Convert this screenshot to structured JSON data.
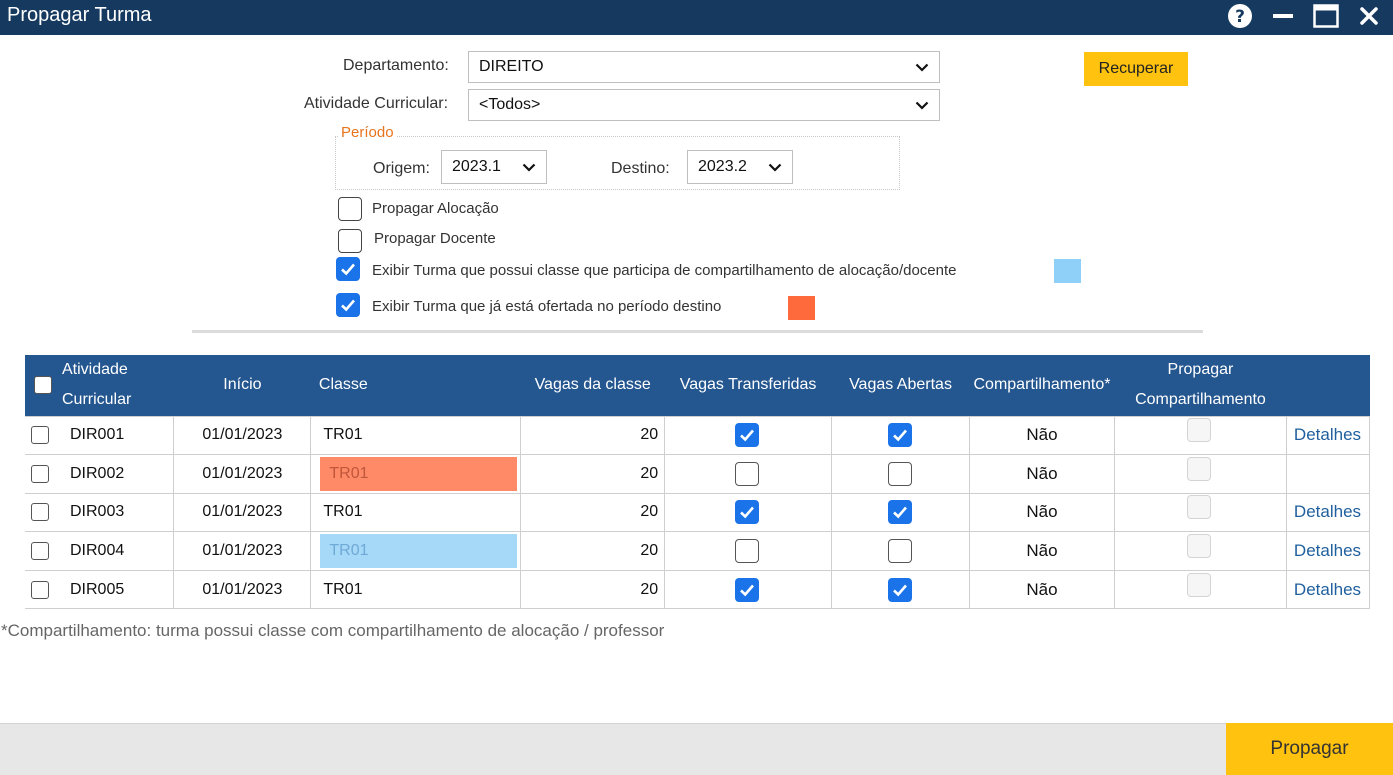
{
  "window": {
    "title": "Propagar Turma"
  },
  "icons": {
    "help": "help-icon",
    "minimize": "minimize-icon",
    "maximize": "maximize-icon",
    "close": "close-icon"
  },
  "filters": {
    "departamento_label": "Departamento:",
    "departamento_value": "DIREITO",
    "atividade_label": "Atividade Curricular:",
    "atividade_value": "<Todos>",
    "recuperar_label": "Recuperar"
  },
  "periodo": {
    "legend": "Período",
    "origem_label": "Origem:",
    "origem_value": "2023.1",
    "destino_label": "Destino:",
    "destino_value": "2023.2"
  },
  "options": {
    "propagar_alocacao": {
      "label": "Propagar Alocação",
      "checked": false
    },
    "propagar_docente": {
      "label": "Propagar Docente",
      "checked": false
    },
    "exibir_compartilhamento": {
      "label": "Exibir Turma que possui classe que participa de compartilhamento de alocação/docente",
      "checked": true,
      "color": "#8fd0f8"
    },
    "exibir_ofertada": {
      "label": "Exibir Turma que já está ofertada no período destino",
      "checked": true,
      "color": "#ff6a3d"
    }
  },
  "table": {
    "headers": {
      "atividade_line1": "Atividade",
      "atividade_line2": "Curricular",
      "inicio": "Início",
      "classe": "Classe",
      "vagas_classe": "Vagas da classe",
      "vagas_transferidas": "Vagas Transferidas",
      "vagas_abertas": "Vagas Abertas",
      "compartilhamento": "Compartilhamento*",
      "propagar_line1": "Propagar",
      "propagar_line2": "Compartilhamento"
    },
    "rows": [
      {
        "atividade": "DIR001",
        "inicio": "01/01/2023",
        "classe": "TR01",
        "vagas": "20",
        "transferidas": true,
        "abertas": true,
        "compartilhamento": "Não",
        "detalhes": "Detalhes"
      },
      {
        "atividade": "DIR002",
        "inicio": "01/01/2023",
        "classe": "TR01",
        "vagas": "20",
        "transferidas": false,
        "abertas": false,
        "compartilhamento": "Não",
        "detalhes": ""
      },
      {
        "atividade": "DIR003",
        "inicio": "01/01/2023",
        "classe": "TR01",
        "vagas": "20",
        "transferidas": true,
        "abertas": true,
        "compartilhamento": "Não",
        "detalhes": "Detalhes"
      },
      {
        "atividade": "DIR004",
        "inicio": "01/01/2023",
        "classe": "TR01",
        "vagas": "20",
        "transferidas": false,
        "abertas": false,
        "compartilhamento": "Não",
        "detalhes": "Detalhes"
      },
      {
        "atividade": "DIR005",
        "inicio": "01/01/2023",
        "classe": "TR01",
        "vagas": "20",
        "transferidas": true,
        "abertas": true,
        "compartilhamento": "Não",
        "detalhes": "Detalhes"
      }
    ],
    "row_highlights": {
      "1": "#ff8a68",
      "3": "#a6d8f8"
    }
  },
  "footnote": "*Compartilhamento: turma possui classe com compartilhamento de alocação / professor",
  "footer": {
    "propagar_label": "Propagar"
  }
}
